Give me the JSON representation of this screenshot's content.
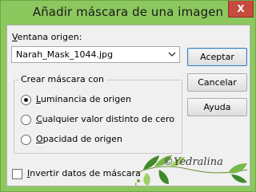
{
  "window": {
    "title": "Añadir máscara de una imagen",
    "close_glyph": "X"
  },
  "source": {
    "label": "Ventana origen:",
    "label_mnemonic": "V",
    "label_rest": "entana origen:",
    "selected_value": "Narah_Mask_1044.jpg"
  },
  "buttons": {
    "accept": "Aceptar",
    "cancel": "Cancelar",
    "help": "Ayuda"
  },
  "mask_group": {
    "title": "Crear máscara con",
    "options": [
      {
        "mnemonic": "L",
        "rest": "uminancia de origen",
        "checked": true
      },
      {
        "mnemonic": "C",
        "rest": "ualquier valor distinto de cero",
        "checked": false
      },
      {
        "mnemonic": "O",
        "rest": "pacidad de origen",
        "checked": false
      }
    ]
  },
  "invert": {
    "mnemonic": "I",
    "rest": "nvertir datos de máscara",
    "checked": false
  },
  "watermark": {
    "text": "©Yedralina",
    "icon": "leaf-branch-icon"
  },
  "colors": {
    "frame": "#8cc85e",
    "close": "#c74a3f",
    "client": "#f0f0f0",
    "leaf_dark": "#3f8a2a",
    "leaf_light": "#9ed163"
  }
}
